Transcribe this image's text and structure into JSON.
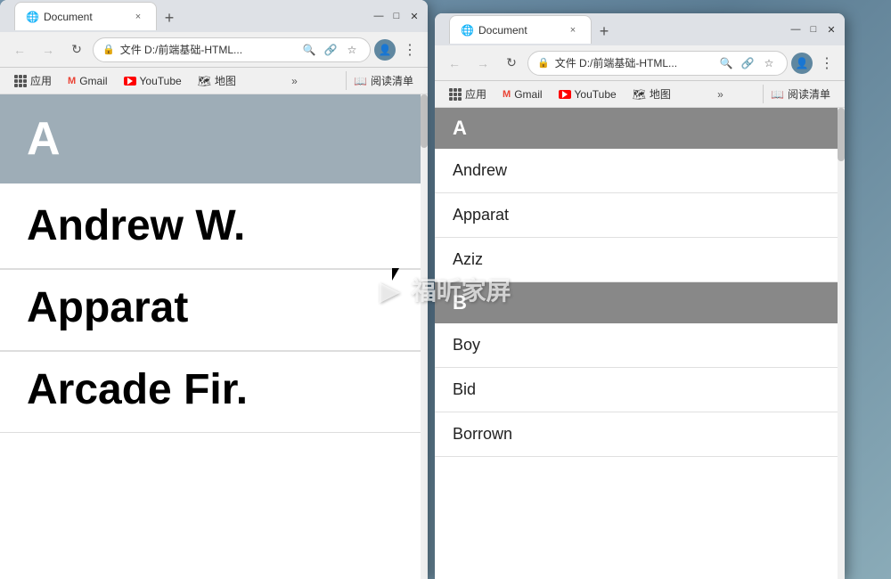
{
  "background": {
    "color": "#6b8fa3"
  },
  "watermark": {
    "text": "福昕家屏"
  },
  "windows": [
    {
      "id": "left",
      "tab": {
        "favicon": "🌐",
        "title": "Document",
        "close": "×"
      },
      "nav": {
        "back": "←",
        "forward": "→",
        "refresh": "↻",
        "address": "文件 D:/前端基础-HTML...",
        "zoom": "🔍",
        "share": "🔗",
        "bookmark": "☆",
        "profile": "👤"
      },
      "bookmarks": {
        "apps_label": "应用",
        "gmail_label": "Gmail",
        "youtube_label": "YouTube",
        "maps_label": "地图",
        "more": "»",
        "reading_list": "阅读清单"
      },
      "content": {
        "letter_header": "A",
        "entries": [
          {
            "name": "Andrew W."
          },
          {
            "name": "Apparat"
          },
          {
            "name": "Arcade Fir."
          }
        ]
      }
    },
    {
      "id": "right",
      "tab": {
        "favicon": "🌐",
        "title": "Document",
        "close": "×"
      },
      "nav": {
        "back": "←",
        "forward": "→",
        "refresh": "↻",
        "address": "文件 D:/前端基础-HTML...",
        "zoom": "🔍",
        "share": "🔗",
        "bookmark": "☆",
        "profile": "👤"
      },
      "bookmarks": {
        "apps_label": "应用",
        "gmail_label": "Gmail",
        "youtube_label": "YouTube",
        "maps_label": "地图",
        "more": "»",
        "reading_list": "阅读清单"
      },
      "content": {
        "sections": [
          {
            "letter": "A",
            "entries": [
              "Andrew",
              "Apparat",
              "Aziz"
            ]
          },
          {
            "letter": "B",
            "entries": [
              "Boy",
              "Bid",
              "Borrown"
            ]
          }
        ]
      }
    }
  ]
}
